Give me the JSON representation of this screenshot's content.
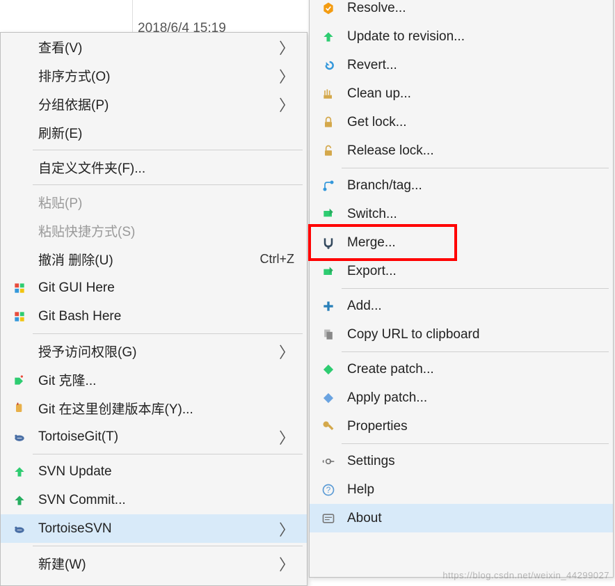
{
  "background": {
    "date": "2018/6/4 15:19"
  },
  "left_menu": {
    "items": [
      {
        "label": "查看(V)",
        "submenu": true
      },
      {
        "label": "排序方式(O)",
        "submenu": true
      },
      {
        "label": "分组依据(P)",
        "submenu": true
      },
      {
        "label": "刷新(E)"
      },
      {
        "sep": true
      },
      {
        "label": "自定义文件夹(F)..."
      },
      {
        "sep": true
      },
      {
        "label": "粘贴(P)",
        "disabled": true
      },
      {
        "label": "粘贴快捷方式(S)",
        "disabled": true
      },
      {
        "label": "撤消 删除(U)",
        "shortcut": "Ctrl+Z"
      },
      {
        "label": "Git GUI Here",
        "icon": "git-gui-icon"
      },
      {
        "label": "Git Bash Here",
        "icon": "git-bash-icon"
      },
      {
        "sep": true
      },
      {
        "label": "授予访问权限(G)",
        "submenu": true
      },
      {
        "label": "Git 克隆...",
        "icon": "git-clone-icon"
      },
      {
        "label": "Git 在这里创建版本库(Y)...",
        "icon": "git-create-repo-icon"
      },
      {
        "label": "TortoiseGit(T)",
        "icon": "tortoisegit-icon",
        "submenu": true
      },
      {
        "sep": true
      },
      {
        "label": "SVN Update",
        "icon": "svn-update-icon"
      },
      {
        "label": "SVN Commit...",
        "icon": "svn-commit-icon"
      },
      {
        "label": "TortoiseSVN",
        "icon": "tortoisesvn-icon",
        "submenu": true,
        "hovered": true
      },
      {
        "sep": true
      },
      {
        "label": "新建(W)",
        "submenu": true
      }
    ]
  },
  "right_menu": {
    "items": [
      {
        "label": "Resolve...",
        "icon": "resolve-icon"
      },
      {
        "label": "Update to revision...",
        "icon": "update-rev-icon"
      },
      {
        "label": "Revert...",
        "icon": "revert-icon"
      },
      {
        "label": "Clean up...",
        "icon": "cleanup-icon"
      },
      {
        "label": "Get lock...",
        "icon": "lock-icon"
      },
      {
        "label": "Release lock...",
        "icon": "unlock-icon"
      },
      {
        "sep": true
      },
      {
        "label": "Branch/tag...",
        "icon": "branch-icon"
      },
      {
        "label": "Switch...",
        "icon": "switch-icon"
      },
      {
        "label": "Merge...",
        "icon": "merge-icon",
        "highlight": true
      },
      {
        "label": "Export...",
        "icon": "export-icon"
      },
      {
        "sep": true
      },
      {
        "label": "Add...",
        "icon": "add-icon"
      },
      {
        "label": "Copy URL to clipboard",
        "icon": "copy-url-icon"
      },
      {
        "sep": true
      },
      {
        "label": "Create patch...",
        "icon": "create-patch-icon"
      },
      {
        "label": "Apply patch...",
        "icon": "apply-patch-icon"
      },
      {
        "label": "Properties",
        "icon": "properties-icon"
      },
      {
        "sep": true
      },
      {
        "label": "Settings",
        "icon": "settings-icon"
      },
      {
        "label": "Help",
        "icon": "help-icon"
      },
      {
        "label": "About",
        "icon": "about-icon",
        "hovered": true
      }
    ]
  },
  "watermark": "https://blog.csdn.net/weixin_44299027"
}
